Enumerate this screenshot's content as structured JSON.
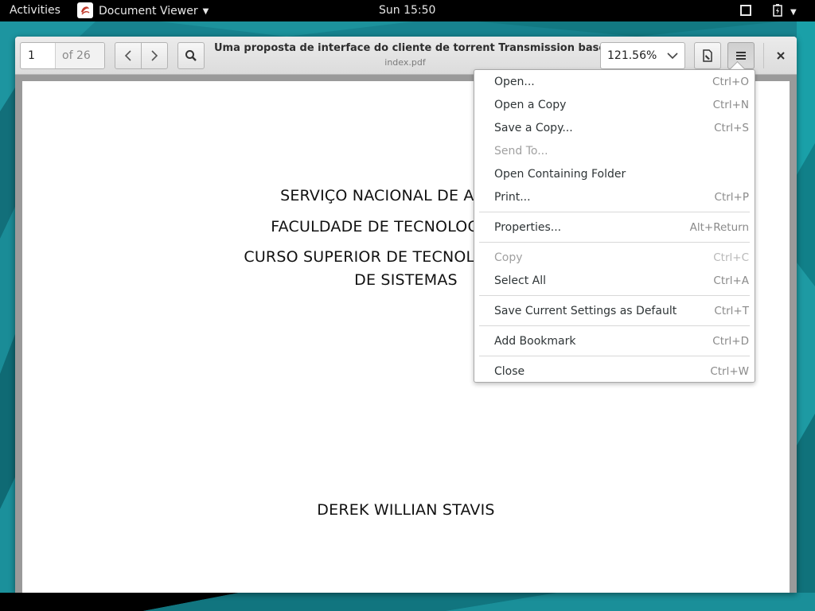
{
  "topbar": {
    "activities": "Activities",
    "app_name": "Document Viewer",
    "clock": "Sun 15:50"
  },
  "toolbar": {
    "page_number": "1",
    "page_total": "of 26",
    "doc_title": "Uma proposta de interface do cliente de torrent Transmission basea...",
    "doc_file": "index.pdf",
    "zoom": "121.56%"
  },
  "document": {
    "lines": [
      "SERVIÇO NACIONAL DE APRENDI",
      "FACULDADE DE TECNOLOGIA SENA",
      "CURSO SUPERIOR DE TECNOLOGIA EM AN",
      "DE SISTEMAS",
      "DEREK WILLIAN STAVIS"
    ]
  },
  "menu": {
    "items": [
      {
        "label": "Open...",
        "accel": "Ctrl+O"
      },
      {
        "label": "Open a Copy",
        "accel": "Ctrl+N"
      },
      {
        "label": "Save a Copy...",
        "accel": "Ctrl+S"
      },
      {
        "label": "Send To...",
        "accel": ""
      },
      {
        "label": "Open Containing Folder",
        "accel": ""
      },
      {
        "label": "Print...",
        "accel": "Ctrl+P"
      },
      {
        "label": "Properties...",
        "accel": "Alt+Return"
      },
      {
        "label": "Copy",
        "accel": "Ctrl+C"
      },
      {
        "label": "Select All",
        "accel": "Ctrl+A"
      },
      {
        "label": "Save Current Settings as Default",
        "accel": "Ctrl+T"
      },
      {
        "label": "Add Bookmark",
        "accel": "Ctrl+D"
      },
      {
        "label": "Close",
        "accel": "Ctrl+W"
      }
    ]
  },
  "colors": {
    "desktop": "#17838f",
    "topbar": "#000000",
    "headerbar": "#e4e4e4"
  }
}
